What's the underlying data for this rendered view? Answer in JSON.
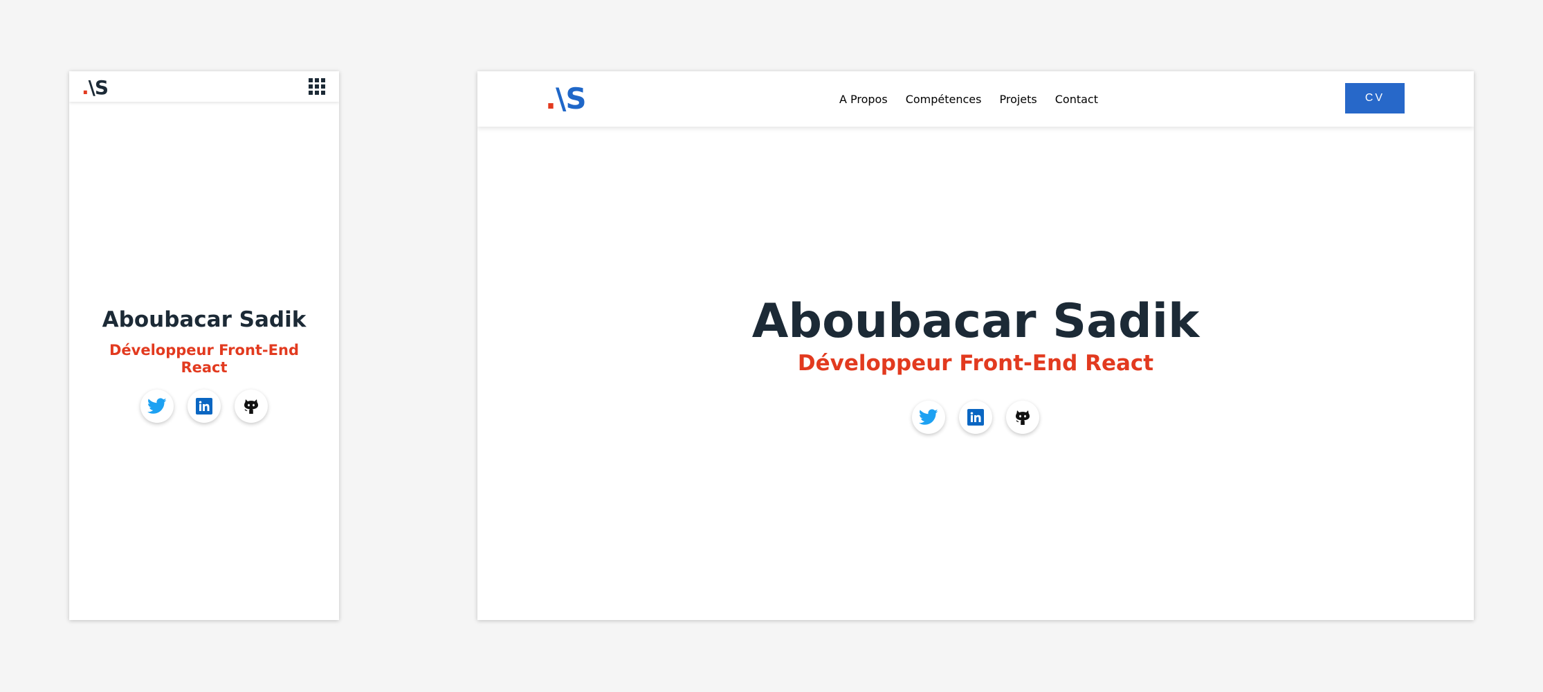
{
  "brand": {
    "logo_dot": ".",
    "logo_text_slash": "\\",
    "logo_text_s": "S"
  },
  "nav": {
    "items": [
      "A Propos",
      "Compétences",
      "Projets",
      "Contact"
    ],
    "cv_label": "CV"
  },
  "hero": {
    "name": "Aboubacar Sadik",
    "role": "Développeur Front-End React"
  },
  "colors": {
    "accent_blue": "#2768c9",
    "accent_red": "#e23a1f",
    "text_dark": "#1c2a36",
    "twitter": "#1da1f2",
    "linkedin": "#0a66c2"
  },
  "socials": [
    {
      "name": "twitter",
      "icon": "twitter-icon"
    },
    {
      "name": "linkedin",
      "icon": "linkedin-icon"
    },
    {
      "name": "github",
      "icon": "github-icon"
    }
  ]
}
